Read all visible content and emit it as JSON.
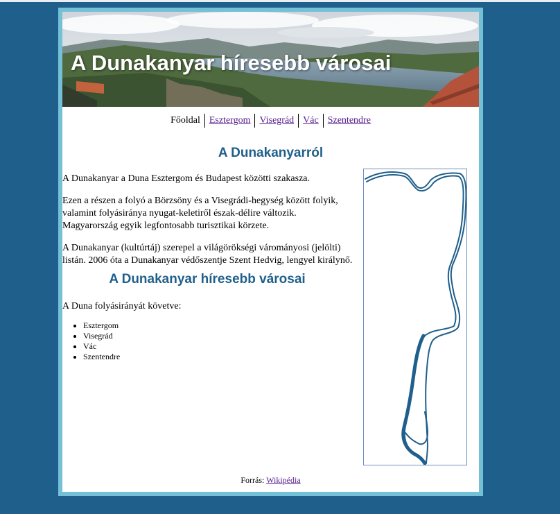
{
  "header": {
    "title": "A Dunakanyar híresebb városai"
  },
  "nav": {
    "current": "Főoldal",
    "links": [
      "Esztergom",
      "Visegrád",
      "Vác",
      "Szentendre"
    ]
  },
  "about": {
    "heading": "A Dunakanyarról",
    "paragraphs": [
      "A Dunakanyar a Duna Esztergom és Budapest közötti szakasza.",
      "Ezen a részen a folyó a Börzsöny és a Visegrádi-hegység között folyik, valamint folyásiránya nyugat-keletiről észak-délire változik. Magyarország egyik legfontosabb turisztikai körzete.",
      "A Dunakanyar (kultúrtáj) szerepel a világörökségi várományosi (jelölti) listán. 2006 óta a Dunakanyar védőszentje Szent Hedvig, lengyel királynő."
    ]
  },
  "towns": {
    "heading": "A Dunakanyar híresebb városai",
    "intro": "A Duna folyásirányát követve:",
    "items": [
      "Esztergom",
      "Visegrád",
      "Vác",
      "Szentendre"
    ]
  },
  "footer": {
    "label": "Forrás:",
    "link": "Wikipédia"
  },
  "colors": {
    "background": "#1f5f8b",
    "frame": "#74c0d6",
    "heading": "#1f5f8b",
    "river": "#1f5f8b"
  }
}
